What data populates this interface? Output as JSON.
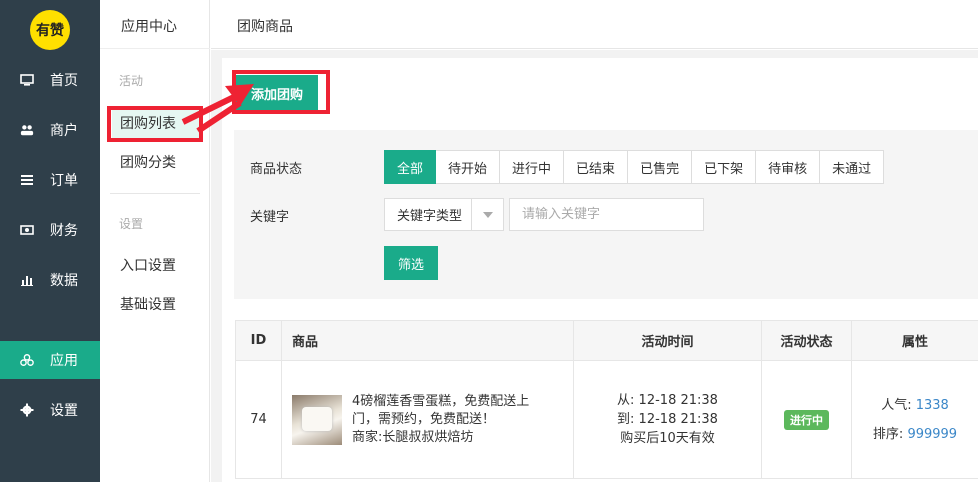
{
  "logo": {
    "text": "有赞"
  },
  "nav": {
    "items": [
      {
        "label": "首页",
        "icon": "monitor-icon"
      },
      {
        "label": "商户",
        "icon": "users-icon"
      },
      {
        "label": "订单",
        "icon": "list-icon"
      },
      {
        "label": "财务",
        "icon": "money-icon"
      },
      {
        "label": "数据",
        "icon": "bar-chart-icon"
      },
      {
        "label": "应用",
        "icon": "apps-icon",
        "active": true
      },
      {
        "label": "设置",
        "icon": "gear-icon"
      }
    ]
  },
  "subnav": {
    "title": "应用中心",
    "group1": "活动",
    "group2": "设置",
    "items": [
      "团购列表",
      "团购分类",
      "入口设置",
      "基础设置"
    ]
  },
  "header": {
    "title": "团购商品"
  },
  "toolbar": {
    "add_label": "添加团购"
  },
  "filter": {
    "status_label": "商品状态",
    "keyword_label": "关键字",
    "status_options": [
      "全部",
      "待开始",
      "进行中",
      "已结束",
      "已售完",
      "已下架",
      "待审核",
      "未通过"
    ],
    "status_selected": "全部",
    "keyword_type": "关键字类型",
    "keyword_placeholder": "请输入关键字",
    "submit_label": "筛选"
  },
  "table": {
    "headers": [
      "ID",
      "商品",
      "活动时间",
      "活动状态",
      "属性"
    ],
    "rows": [
      {
        "id": "74",
        "goods_line1": "4磅榴莲香雪蛋糕，免费配送上",
        "goods_line2": "门，需预约，免费配送！",
        "goods_line3": "商家:长腿叔叔烘焙坊",
        "time_from": "从:  12-18 21:38",
        "time_to": "到:  12-18 21:38",
        "time_valid": "购买后10天有效",
        "status": "进行中",
        "popularity_label": "人气:",
        "popularity": "1338",
        "sort_label": "排序:",
        "sort": "999999"
      }
    ]
  },
  "colors": {
    "accent": "#1aab8a",
    "sidebar": "#2f3f4a",
    "annotation": "#ee2233",
    "link": "#3b87c8"
  }
}
